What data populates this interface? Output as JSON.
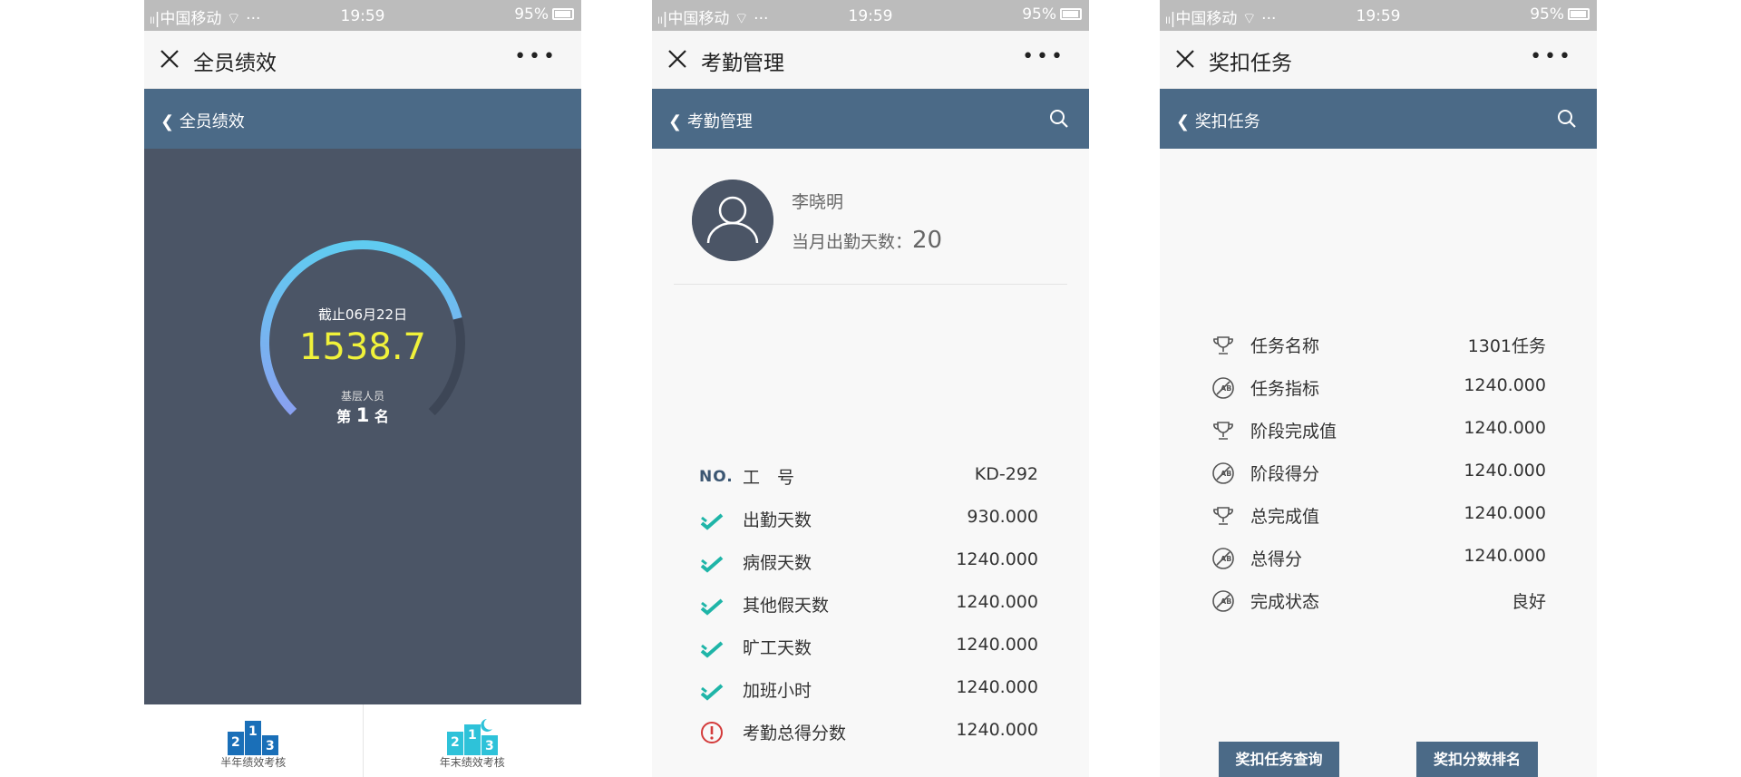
{
  "status": {
    "carrier": "中国移动",
    "time": "19:59",
    "battery": "95%"
  },
  "panel1": {
    "window_title": "全员绩效",
    "nav_back": "全员绩效",
    "gauge": {
      "date": "截止06月22日",
      "score": "1538.7",
      "level": "基层人员",
      "rank_prefix": "第",
      "rank_num": "1",
      "rank_suffix": "名",
      "progress": 0.78
    },
    "tabs": [
      {
        "label": "半年绩效考核",
        "icon": "podium-icon"
      },
      {
        "label": "年末绩效考核",
        "icon": "podium-moon-icon"
      }
    ]
  },
  "panel2": {
    "window_title": "考勤管理",
    "nav_back": "考勤管理",
    "profile": {
      "name": "李晓明",
      "days_label": "当月出勤天数：",
      "days_value": "20"
    },
    "rows": [
      {
        "icon": "no-icon",
        "label": "工　号",
        "value": "KD-292"
      },
      {
        "icon": "check-icon",
        "label": "出勤天数",
        "value": "930.000"
      },
      {
        "icon": "check-icon",
        "label": "病假天数",
        "value": "1240.000"
      },
      {
        "icon": "check-icon",
        "label": "其他假天数",
        "value": "1240.000"
      },
      {
        "icon": "check-icon",
        "label": "旷工天数",
        "value": "1240.000"
      },
      {
        "icon": "check-icon",
        "label": "加班小时",
        "value": "1240.000"
      },
      {
        "icon": "alert-icon",
        "label": "考勤总得分数",
        "value": "1240.000"
      }
    ],
    "no_text": "NO."
  },
  "panel3": {
    "window_title": "奖扣任务",
    "nav_back": "奖扣任务",
    "rows": [
      {
        "icon": "trophy-icon",
        "label": "任务名称",
        "value": "1301任务"
      },
      {
        "icon": "ab-icon",
        "label": "任务指标",
        "value": "1240.000"
      },
      {
        "icon": "trophy-icon",
        "label": "阶段完成值",
        "value": "1240.000"
      },
      {
        "icon": "ab-icon",
        "label": "阶段得分",
        "value": "1240.000"
      },
      {
        "icon": "trophy-icon",
        "label": "总完成值",
        "value": "1240.000"
      },
      {
        "icon": "ab-icon",
        "label": "总得分",
        "value": "1240.000"
      },
      {
        "icon": "ab-icon",
        "label": "完成状态",
        "value": "良好"
      }
    ],
    "buttons": [
      "奖扣任务查询",
      "奖扣分数排名"
    ]
  },
  "colors": {
    "nav": "#4b6a87",
    "panel_dark": "#4b5566",
    "score": "#f0f23a",
    "check": "#1fb5a8",
    "alert": "#d33a3a"
  }
}
